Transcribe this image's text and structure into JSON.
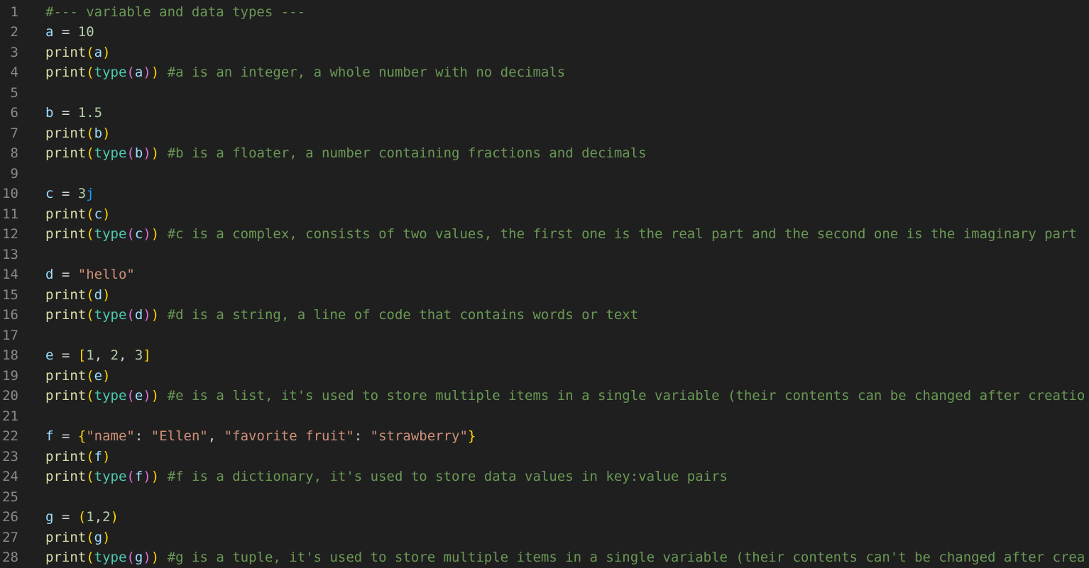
{
  "editor": {
    "language": "python",
    "colors": {
      "background": "#1f1f1f",
      "line_number": "#8a8a8a",
      "default": "#d4d4d4",
      "variable": "#9cdcfe",
      "function": "#dcdcaa",
      "builtin": "#4ec9b0",
      "number": "#b5cea8",
      "string": "#ce9178",
      "comment": "#6a9955",
      "bracket_level1": "#ffd700",
      "bracket_level2": "#da70d6",
      "bracket_level3": "#179fff"
    },
    "lines": [
      {
        "n": "1",
        "tokens": [
          {
            "t": "#--- variable and data types ---",
            "c": "comment"
          }
        ]
      },
      {
        "n": "2",
        "tokens": [
          {
            "t": "a",
            "c": "var"
          },
          {
            "t": " = ",
            "c": "default"
          },
          {
            "t": "10",
            "c": "num"
          }
        ]
      },
      {
        "n": "3",
        "tokens": [
          {
            "t": "print",
            "c": "func"
          },
          {
            "t": "(",
            "c": "paren1"
          },
          {
            "t": "a",
            "c": "var"
          },
          {
            "t": ")",
            "c": "paren1"
          }
        ]
      },
      {
        "n": "4",
        "tokens": [
          {
            "t": "print",
            "c": "func"
          },
          {
            "t": "(",
            "c": "paren1"
          },
          {
            "t": "type",
            "c": "builtin"
          },
          {
            "t": "(",
            "c": "paren2"
          },
          {
            "t": "a",
            "c": "var"
          },
          {
            "t": ")",
            "c": "paren2"
          },
          {
            "t": ")",
            "c": "paren1"
          },
          {
            "t": " ",
            "c": "default"
          },
          {
            "t": "#a is an integer, a whole number with no decimals",
            "c": "comment"
          }
        ]
      },
      {
        "n": "5",
        "tokens": []
      },
      {
        "n": "6",
        "tokens": [
          {
            "t": "b",
            "c": "var"
          },
          {
            "t": " = ",
            "c": "default"
          },
          {
            "t": "1.5",
            "c": "num"
          }
        ]
      },
      {
        "n": "7",
        "tokens": [
          {
            "t": "print",
            "c": "func"
          },
          {
            "t": "(",
            "c": "paren1"
          },
          {
            "t": "b",
            "c": "var"
          },
          {
            "t": ")",
            "c": "paren1"
          }
        ]
      },
      {
        "n": "8",
        "tokens": [
          {
            "t": "print",
            "c": "func"
          },
          {
            "t": "(",
            "c": "paren1"
          },
          {
            "t": "type",
            "c": "builtin"
          },
          {
            "t": "(",
            "c": "paren2"
          },
          {
            "t": "b",
            "c": "var"
          },
          {
            "t": ")",
            "c": "paren2"
          },
          {
            "t": ")",
            "c": "paren1"
          },
          {
            "t": " ",
            "c": "default"
          },
          {
            "t": "#b is a floater, a number containing fractions and decimals",
            "c": "comment"
          }
        ]
      },
      {
        "n": "9",
        "tokens": []
      },
      {
        "n": "10",
        "tokens": [
          {
            "t": "c",
            "c": "var"
          },
          {
            "t": " = ",
            "c": "default"
          },
          {
            "t": "3",
            "c": "num"
          },
          {
            "t": "j",
            "c": "paren3"
          }
        ]
      },
      {
        "n": "11",
        "tokens": [
          {
            "t": "print",
            "c": "func"
          },
          {
            "t": "(",
            "c": "paren1"
          },
          {
            "t": "c",
            "c": "var"
          },
          {
            "t": ")",
            "c": "paren1"
          }
        ]
      },
      {
        "n": "12",
        "tokens": [
          {
            "t": "print",
            "c": "func"
          },
          {
            "t": "(",
            "c": "paren1"
          },
          {
            "t": "type",
            "c": "builtin"
          },
          {
            "t": "(",
            "c": "paren2"
          },
          {
            "t": "c",
            "c": "var"
          },
          {
            "t": ")",
            "c": "paren2"
          },
          {
            "t": ")",
            "c": "paren1"
          },
          {
            "t": " ",
            "c": "default"
          },
          {
            "t": "#c is a complex, consists of two values, the first one is the real part and the second one is the imaginary part",
            "c": "comment"
          }
        ]
      },
      {
        "n": "13",
        "tokens": []
      },
      {
        "n": "14",
        "tokens": [
          {
            "t": "d",
            "c": "var"
          },
          {
            "t": " = ",
            "c": "default"
          },
          {
            "t": "\"hello\"",
            "c": "str"
          }
        ]
      },
      {
        "n": "15",
        "tokens": [
          {
            "t": "print",
            "c": "func"
          },
          {
            "t": "(",
            "c": "paren1"
          },
          {
            "t": "d",
            "c": "var"
          },
          {
            "t": ")",
            "c": "paren1"
          }
        ]
      },
      {
        "n": "16",
        "tokens": [
          {
            "t": "print",
            "c": "func"
          },
          {
            "t": "(",
            "c": "paren1"
          },
          {
            "t": "type",
            "c": "builtin"
          },
          {
            "t": "(",
            "c": "paren2"
          },
          {
            "t": "d",
            "c": "var"
          },
          {
            "t": ")",
            "c": "paren2"
          },
          {
            "t": ")",
            "c": "paren1"
          },
          {
            "t": " ",
            "c": "default"
          },
          {
            "t": "#d is a string, a line of code that contains words or text",
            "c": "comment"
          }
        ]
      },
      {
        "n": "17",
        "tokens": []
      },
      {
        "n": "18",
        "tokens": [
          {
            "t": "e",
            "c": "var"
          },
          {
            "t": " = ",
            "c": "default"
          },
          {
            "t": "[",
            "c": "paren1"
          },
          {
            "t": "1",
            "c": "num"
          },
          {
            "t": ", ",
            "c": "default"
          },
          {
            "t": "2",
            "c": "num"
          },
          {
            "t": ", ",
            "c": "default"
          },
          {
            "t": "3",
            "c": "num"
          },
          {
            "t": "]",
            "c": "paren1"
          }
        ]
      },
      {
        "n": "19",
        "tokens": [
          {
            "t": "print",
            "c": "func"
          },
          {
            "t": "(",
            "c": "paren1"
          },
          {
            "t": "e",
            "c": "var"
          },
          {
            "t": ")",
            "c": "paren1"
          }
        ]
      },
      {
        "n": "20",
        "tokens": [
          {
            "t": "print",
            "c": "func"
          },
          {
            "t": "(",
            "c": "paren1"
          },
          {
            "t": "type",
            "c": "builtin"
          },
          {
            "t": "(",
            "c": "paren2"
          },
          {
            "t": "e",
            "c": "var"
          },
          {
            "t": ")",
            "c": "paren2"
          },
          {
            "t": ")",
            "c": "paren1"
          },
          {
            "t": " ",
            "c": "default"
          },
          {
            "t": "#e is a list, it's used to store multiple items in a single variable (their contents can be changed after creatio",
            "c": "comment"
          }
        ]
      },
      {
        "n": "21",
        "tokens": []
      },
      {
        "n": "22",
        "tokens": [
          {
            "t": "f",
            "c": "var"
          },
          {
            "t": " = ",
            "c": "default"
          },
          {
            "t": "{",
            "c": "paren1"
          },
          {
            "t": "\"name\"",
            "c": "str"
          },
          {
            "t": ": ",
            "c": "default"
          },
          {
            "t": "\"Ellen\"",
            "c": "str"
          },
          {
            "t": ", ",
            "c": "default"
          },
          {
            "t": "\"favorite fruit\"",
            "c": "str"
          },
          {
            "t": ": ",
            "c": "default"
          },
          {
            "t": "\"strawberry\"",
            "c": "str"
          },
          {
            "t": "}",
            "c": "paren1"
          }
        ]
      },
      {
        "n": "23",
        "tokens": [
          {
            "t": "print",
            "c": "func"
          },
          {
            "t": "(",
            "c": "paren1"
          },
          {
            "t": "f",
            "c": "var"
          },
          {
            "t": ")",
            "c": "paren1"
          }
        ]
      },
      {
        "n": "24",
        "tokens": [
          {
            "t": "print",
            "c": "func"
          },
          {
            "t": "(",
            "c": "paren1"
          },
          {
            "t": "type",
            "c": "builtin"
          },
          {
            "t": "(",
            "c": "paren2"
          },
          {
            "t": "f",
            "c": "var"
          },
          {
            "t": ")",
            "c": "paren2"
          },
          {
            "t": ")",
            "c": "paren1"
          },
          {
            "t": " ",
            "c": "default"
          },
          {
            "t": "#f is a dictionary, it's used to store data values in key:value pairs",
            "c": "comment"
          }
        ]
      },
      {
        "n": "25",
        "tokens": []
      },
      {
        "n": "26",
        "tokens": [
          {
            "t": "g",
            "c": "var"
          },
          {
            "t": " = ",
            "c": "default"
          },
          {
            "t": "(",
            "c": "paren1"
          },
          {
            "t": "1",
            "c": "num"
          },
          {
            "t": ",",
            "c": "default"
          },
          {
            "t": "2",
            "c": "num"
          },
          {
            "t": ")",
            "c": "paren1"
          }
        ]
      },
      {
        "n": "27",
        "tokens": [
          {
            "t": "print",
            "c": "func"
          },
          {
            "t": "(",
            "c": "paren1"
          },
          {
            "t": "g",
            "c": "var"
          },
          {
            "t": ")",
            "c": "paren1"
          }
        ]
      },
      {
        "n": "28",
        "tokens": [
          {
            "t": "print",
            "c": "func"
          },
          {
            "t": "(",
            "c": "paren1"
          },
          {
            "t": "type",
            "c": "builtin"
          },
          {
            "t": "(",
            "c": "paren2"
          },
          {
            "t": "g",
            "c": "var"
          },
          {
            "t": ")",
            "c": "paren2"
          },
          {
            "t": ")",
            "c": "paren1"
          },
          {
            "t": " ",
            "c": "default"
          },
          {
            "t": "#g is a tuple, it's used to store multiple items in a single variable (their contents can't be changed after crea",
            "c": "comment"
          }
        ]
      }
    ]
  }
}
